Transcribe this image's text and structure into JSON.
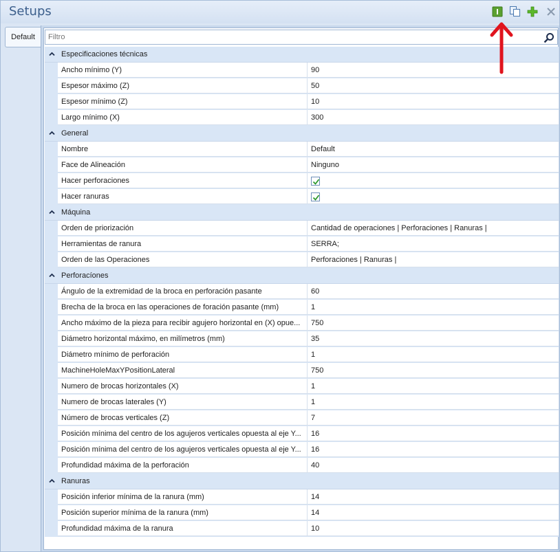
{
  "window": {
    "title": "Setups"
  },
  "toolbar": {
    "buttons": [
      {
        "icon": "green-bar-icon",
        "color": "#5aa030"
      },
      {
        "icon": "copy-icon"
      },
      {
        "icon": "add-icon",
        "color": "#5cb82a"
      },
      {
        "icon": "close-icon"
      }
    ]
  },
  "tabs": [
    {
      "label": "Default"
    }
  ],
  "filter": {
    "placeholder": "Filtro",
    "value": ""
  },
  "categories": [
    {
      "label": "Especificaciones técnicas",
      "rows": [
        {
          "name": "Ancho mínimo (Y)",
          "value": "90"
        },
        {
          "name": "Espesor máximo (Z)",
          "value": "50"
        },
        {
          "name": "Espesor mínimo (Z)",
          "value": "10"
        },
        {
          "name": "Largo mínimo (X)",
          "value": "300"
        }
      ]
    },
    {
      "label": "General",
      "rows": [
        {
          "name": "Nombre",
          "value": "Default"
        },
        {
          "name": "Face de Alineación",
          "value": "Ninguno"
        },
        {
          "name": "Hacer perforaciones",
          "value": "",
          "checked": true
        },
        {
          "name": "Hacer ranuras",
          "value": "",
          "checked": true
        }
      ]
    },
    {
      "label": "Máquina",
      "rows": [
        {
          "name": "Orden de priorización",
          "value": "Cantidad de operaciones | Perforaciones | Ranuras |"
        },
        {
          "name": "Herramientas de ranura",
          "value": "SERRA;"
        },
        {
          "name": "Orden de las Operaciones",
          "value": "Perforaciones | Ranuras |"
        }
      ]
    },
    {
      "label": "Perforacíones",
      "rows": [
        {
          "name": "Ángulo de la extremidad de la broca en perforación pasante",
          "value": "60"
        },
        {
          "name": "Brecha de la broca en las operaciones de foración pasante (mm)",
          "value": "1"
        },
        {
          "name": "Ancho máximo de la pieza para recibir agujero horizontal en (X) opue...",
          "value": "750"
        },
        {
          "name": "Diámetro horizontal máximo, en milímetros (mm)",
          "value": "35"
        },
        {
          "name": "Diámetro mínimo de perforación",
          "value": "1"
        },
        {
          "name": "MachineHoleMaxYPositionLateral",
          "value": "750"
        },
        {
          "name": "Numero de brocas horizontales (X)",
          "value": "1"
        },
        {
          "name": "Numero de brocas laterales (Y)",
          "value": "1"
        },
        {
          "name": "Número de brocas verticales (Z)",
          "value": "7"
        },
        {
          "name": "Posición mínima del centro de los agujeros verticales opuesta al eje Y...",
          "value": "16"
        },
        {
          "name": "Posición mínima del centro de los agujeros verticales opuesta al eje Y...",
          "value": "16"
        },
        {
          "name": "Profundidad máxima de la perforación",
          "value": "40"
        }
      ]
    },
    {
      "label": "Ranuras",
      "rows": [
        {
          "name": "Posición inferior mínima de la ranura (mm)",
          "value": "14"
        },
        {
          "name": "Posición superior mínima de la ranura (mm)",
          "value": "14"
        },
        {
          "name": "Profundidad máxima de la ranura",
          "value": "10"
        }
      ]
    }
  ],
  "annotation": {
    "color": "#e0141e"
  }
}
